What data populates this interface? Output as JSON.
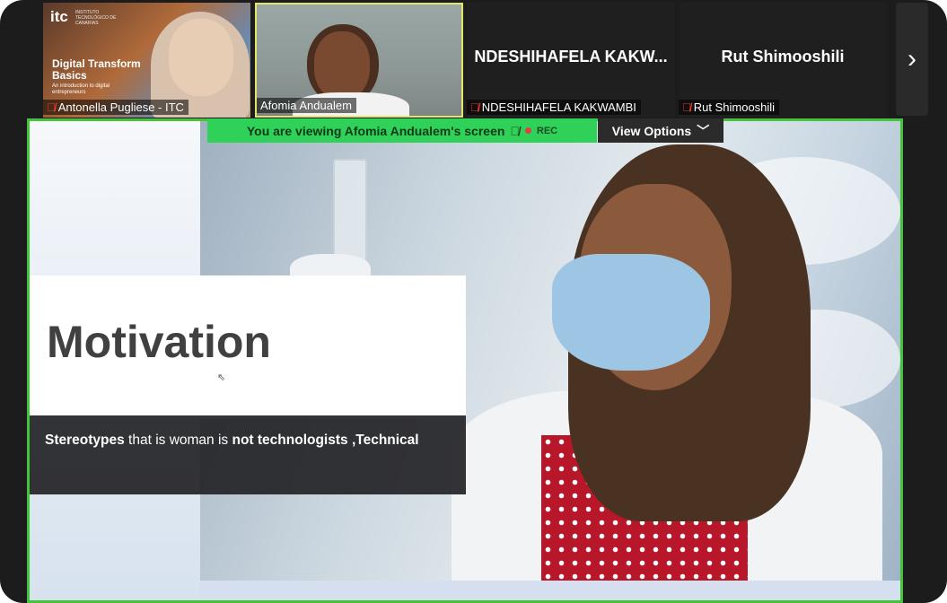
{
  "gallery": {
    "tiles": [
      {
        "name_label": "Antonella Pugliese - ITC",
        "muted": true,
        "slide": {
          "logo": "itc",
          "logo_sub": "INSTITUTO TECNOLÓGICO DE CANARIAS",
          "title": "Digital Transform",
          "title2": "Basics",
          "subtitle": "An introduction to digital entrepreneurs"
        }
      },
      {
        "name_label": "Afomia Andualem",
        "muted": false
      },
      {
        "display_name": "NDESHIHAFELA KAKW...",
        "name_label": "NDESHIHAFELA KAKWAMBI",
        "muted": true
      },
      {
        "display_name": "Rut Shimooshili",
        "name_label": "Rut Shimooshili",
        "muted": true
      }
    ],
    "next_icon": "chevron-right-icon"
  },
  "share_banner": {
    "text": "You are viewing  Afomia Andualem's screen",
    "rec_label": "REC"
  },
  "view_options": {
    "label": "View Options"
  },
  "slide": {
    "title": "Motivation",
    "caption_bold1": "Stereotypes",
    "caption_mid": " that is woman is ",
    "caption_bold2": "not technologists ,Technical"
  },
  "colors": {
    "share_banner": "#30d158",
    "active_speaker_border": "#e3e36a",
    "screen_border": "#45c33a",
    "muted": "#e8392f"
  }
}
